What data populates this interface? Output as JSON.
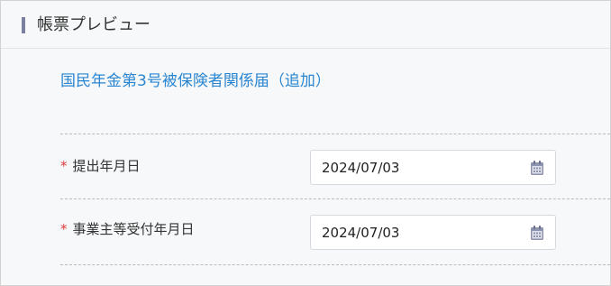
{
  "header": {
    "title": "帳票プレビュー"
  },
  "form": {
    "title": "国民年金第3号被保険者関係届（追加）",
    "fields": [
      {
        "required_mark": "*",
        "label": "提出年月日",
        "value": "2024/07/03",
        "icon": "calendar-icon"
      },
      {
        "required_mark": "*",
        "label": "事業主等受付年月日",
        "value": "2024/07/03",
        "icon": "calendar-icon"
      }
    ]
  },
  "colors": {
    "accent_bar": "#7a7f9e",
    "title_link": "#2a86d1",
    "required": "#e03a3a"
  }
}
